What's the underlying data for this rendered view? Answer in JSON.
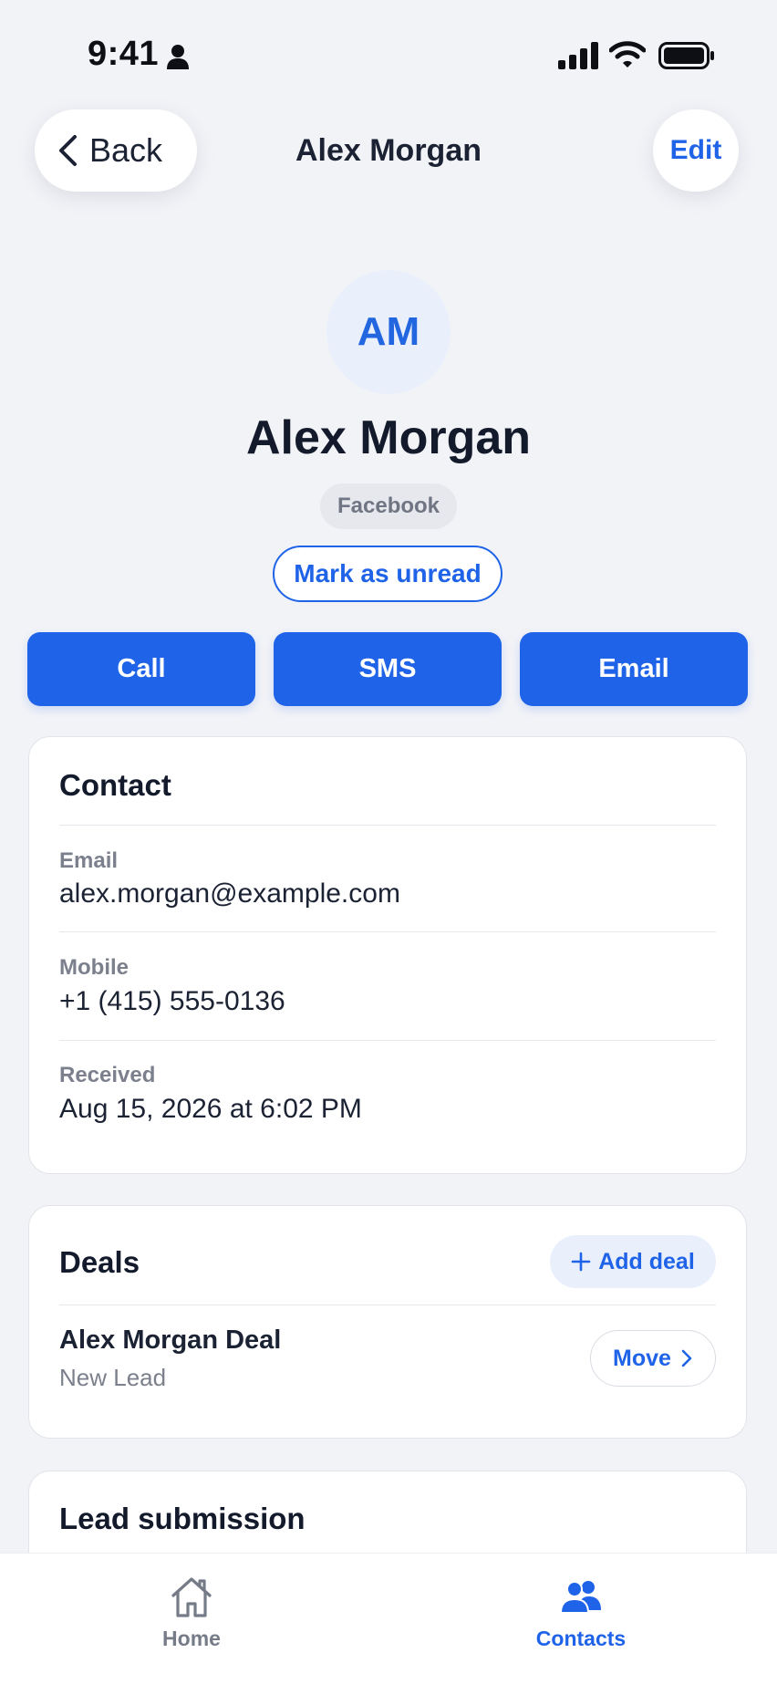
{
  "status_bar": {
    "time": "9:41"
  },
  "nav": {
    "back_label": "Back",
    "title": "Alex Morgan",
    "edit_label": "Edit"
  },
  "profile": {
    "initials": "AM",
    "name": "Alex Morgan",
    "source": "Facebook",
    "mark_unread_label": "Mark as unread"
  },
  "actions": {
    "call": "Call",
    "sms": "SMS",
    "email": "Email"
  },
  "contact": {
    "title": "Contact",
    "fields": [
      {
        "label": "Email",
        "value": "alex.morgan@example.com"
      },
      {
        "label": "Mobile",
        "value": "+1 (415) 555-0136"
      },
      {
        "label": "Received",
        "value": "Aug 15, 2026 at 6:02 PM"
      }
    ]
  },
  "deals": {
    "title": "Deals",
    "add_label": "Add deal",
    "items": [
      {
        "name": "Alex Morgan Deal",
        "stage": "New Lead",
        "move_label": "Move"
      }
    ]
  },
  "lead_submission": {
    "title": "Lead submission"
  },
  "tab_bar": {
    "tabs": [
      {
        "label": "Home",
        "icon": "home-icon",
        "active": false
      },
      {
        "label": "Contacts",
        "icon": "contacts-icon",
        "active": true
      }
    ]
  },
  "colors": {
    "accent": "#1f63e8",
    "background": "#f2f3f7",
    "text": "#131a2b",
    "muted": "#7b808c"
  }
}
